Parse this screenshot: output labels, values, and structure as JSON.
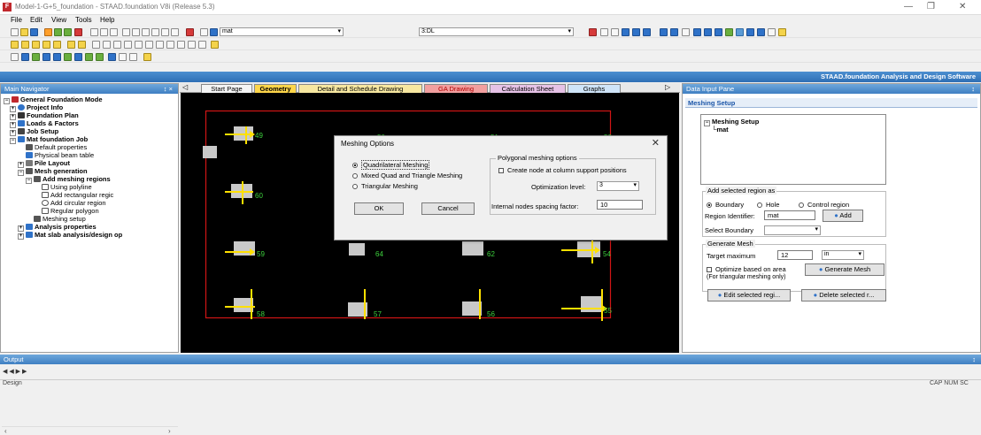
{
  "window": {
    "title": "Model-1-G+5_foundation - STAAD.foundation V8i (Release 5.3)",
    "icon_letter": "F"
  },
  "menu": [
    "File",
    "Edit",
    "View",
    "Tools",
    "Help"
  ],
  "toolbar": {
    "select_mat": "mat",
    "select_case": "3:DL"
  },
  "brand": "STAAD.foundation Analysis and Design Software",
  "nav": {
    "title": "Main Navigator",
    "pin": "↕ ×",
    "items": [
      {
        "label": "General Foundation Mode",
        "bold": true
      },
      {
        "label": "Project Info",
        "bold": true
      },
      {
        "label": "Foundation Plan",
        "bold": true
      },
      {
        "label": "Loads & Factors",
        "bold": true
      },
      {
        "label": "Job Setup",
        "bold": true
      },
      {
        "label": "Mat foundation Job",
        "bold": true
      },
      {
        "label": "Default properties",
        "bold": false
      },
      {
        "label": "Physical beam table",
        "bold": false
      },
      {
        "label": "Pile Layout",
        "bold": true
      },
      {
        "label": "Mesh generation",
        "bold": true
      },
      {
        "label": "Add meshing regions",
        "bold": true
      },
      {
        "label": "Using polyline",
        "bold": false
      },
      {
        "label": "Add rectangular regic",
        "bold": false
      },
      {
        "label": "Add circular region",
        "bold": false
      },
      {
        "label": "Regular polygon",
        "bold": false
      },
      {
        "label": "Meshing setup",
        "bold": false
      },
      {
        "label": "Analysis properties",
        "bold": true
      },
      {
        "label": "Mat slab analysis/design op",
        "bold": true
      }
    ]
  },
  "tabs": [
    "Start Page",
    "Geometry",
    "Detail and Schedule Drawing",
    "GA Drawing",
    "Calculation Sheet",
    "Graphs"
  ],
  "canvas_labels": [
    "49",
    "50",
    "51",
    "52",
    "60",
    "59",
    "64",
    "62",
    "54",
    "58",
    "57",
    "56",
    "55"
  ],
  "dialog": {
    "title": "Meshing Options",
    "close": "✕",
    "options": [
      "Quadrilateral Meshing",
      "Mixed Quad and Triangle Meshing",
      "Triangular Meshing"
    ],
    "selected_option": "Quadrilateral Meshing",
    "ok": "OK",
    "cancel": "Cancel",
    "poly_group": "Polygonal meshing options",
    "create_node": "Create node at column support positions",
    "opt_level_label": "Optimization level:",
    "opt_level_value": "3",
    "spacing_label": "Internal nodes spacing factor:",
    "spacing_value": "10"
  },
  "dip": {
    "title": "Data Input Pane",
    "pin": "↕",
    "tab": "Meshing Setup",
    "tree_root": "Meshing Setup",
    "tree_child": "mat",
    "region_group": "Add selected region as",
    "boundary": "Boundary",
    "hole": "Hole",
    "control": "Control region",
    "region_id_label": "Region Identifier:",
    "region_id_value": "mat",
    "add": "Add",
    "select_boundary_label": "Select Boundary",
    "gen_group": "Generate Mesh",
    "target_label": "Target maximum",
    "target_value": "12",
    "unit": "in",
    "optimize": "Optimize based on area",
    "optimize_note": "(For triangular meshing only)",
    "generate": "Generate Mesh",
    "edit_sel": "Edit selected regi...",
    "delete_sel": "Delete selected r..."
  },
  "output": {
    "title": "Output",
    "pin": "↕",
    "nav": "◀ ◀ ▶ ▶"
  },
  "status": {
    "left": "Design",
    "right": "CAP NUM SC"
  }
}
